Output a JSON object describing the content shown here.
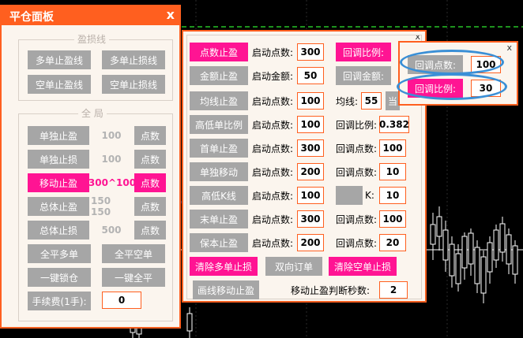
{
  "left_panel": {
    "title": "平仓面板",
    "close": "x",
    "profit_loss_group": {
      "label": "盈损线",
      "buttons": [
        "多单止盈线",
        "多单止损线",
        "空单止盈线",
        "空单止损线"
      ]
    },
    "global_group": {
      "label": "全 局",
      "rows": [
        {
          "button": "单独止盈",
          "value": "100",
          "unit": "点数",
          "active": false
        },
        {
          "button": "单独止损",
          "value": "100",
          "unit": "点数",
          "active": false
        },
        {
          "button": "移动止盈",
          "value": "300^100",
          "unit": "点数",
          "active": true
        },
        {
          "button": "总体止盈",
          "value": "150 150",
          "unit": "点数",
          "active": false
        },
        {
          "button": "总体止损",
          "value": "500",
          "unit": "点数",
          "active": false
        }
      ],
      "buttons": [
        "全平多单",
        "全平空单",
        "一键锁仓",
        "一键全平"
      ],
      "fee_label": "手续费(1手):",
      "fee_value": "0"
    }
  },
  "mid_panel": {
    "close": "x",
    "rows": [
      {
        "button": "点数止盈",
        "active": true,
        "label1": "启动点数:",
        "value1": "300",
        "button2": "回调比例:",
        "button2_active": true
      },
      {
        "button": "金额止盈",
        "active": false,
        "label1": "启动金额:",
        "value1": "50",
        "button2": "回调金额:",
        "button2_active": false
      },
      {
        "button": "均线止盈",
        "active": false,
        "label1": "启动点数:",
        "value1": "100",
        "label2": "均线:",
        "value2": "55",
        "button3": "当"
      },
      {
        "button": "高低单比例",
        "active": false,
        "label1": "启动点数:",
        "value1": "100",
        "label2": "回调比例:",
        "value2": "0.382"
      },
      {
        "button": "首单止盈",
        "active": false,
        "label1": "启动点数:",
        "value1": "300",
        "label2": "回调点数:",
        "value2": "100"
      },
      {
        "button": "单独移动",
        "active": false,
        "label1": "启动点数:",
        "value1": "200",
        "label2": "回调点数:",
        "value2": "10"
      },
      {
        "button": "高低K线",
        "active": false,
        "label1": "启动点数:",
        "value1": "100",
        "button2": "",
        "label2": "K:",
        "value2": "10"
      },
      {
        "button": "末单止盈",
        "active": false,
        "label1": "启动点数:",
        "value1": "300",
        "label2": "回调点数:",
        "value2": "100"
      },
      {
        "button": "保本止盈",
        "active": false,
        "label1": "启动点数:",
        "value1": "200",
        "label2": "回调点数:",
        "value2": "20"
      }
    ],
    "bottom_buttons": [
      {
        "label": "清除多单止损",
        "active": true
      },
      {
        "label": "双向订单",
        "active": false
      },
      {
        "label": "清除空单止损",
        "active": true
      }
    ],
    "draw_button": "画线移动止盈",
    "seconds_label": "移动止盈判断秒数:",
    "seconds_value": "2"
  },
  "right_panel": {
    "close": "x",
    "rows": [
      {
        "label": "回调点数:",
        "value": "100",
        "active": false
      },
      {
        "label": "回调比例:",
        "value": "30",
        "active": true
      }
    ]
  },
  "colors": {
    "accent": "#ff5f1f",
    "pink": "#ff1493",
    "gray_button": "#a6a6a6",
    "panel_bg": "#fbf5ee",
    "ellipse": "#3a8fd6"
  }
}
